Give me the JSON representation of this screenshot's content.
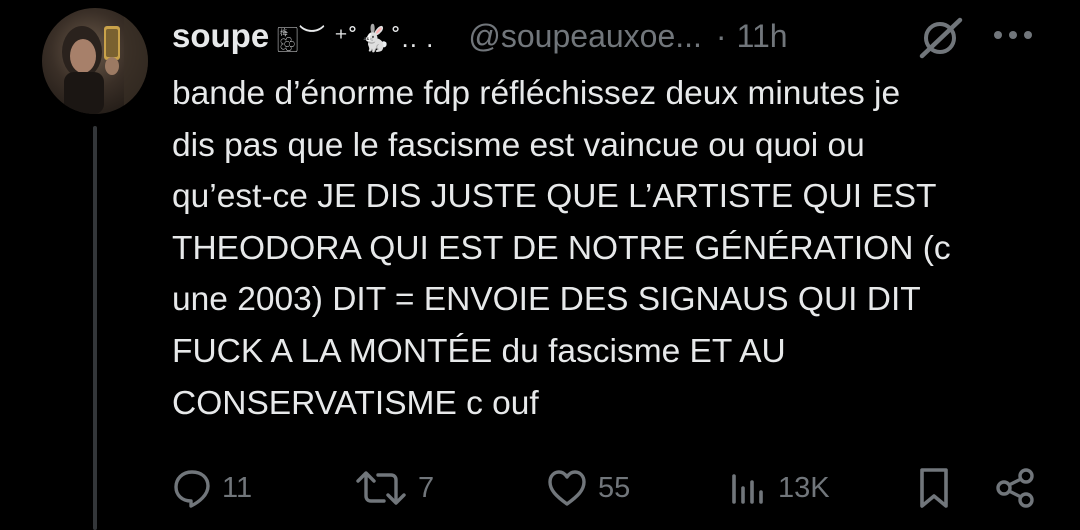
{
  "author": {
    "display_name": "soupe",
    "name_decoration": "🀢︶ ⁺˚🐇˚.. .",
    "handle": "@soupeauxoe...",
    "separator": "·",
    "time": "11h"
  },
  "tweet": {
    "text": "bande d’énorme fdp réfléchissez deux minutes je\ndis pas que le fascisme est vaincue ou quoi ou\nqu’est-ce JE DIS JUSTE QUE L’ARTISTE QUI EST\nTHEODORA QUI EST DE NOTRE GÉNÉRATION (c\nune 2003) DIT = ENVOIE DES SIGNAUS QUI DIT\nFUCK A LA MONTÉE du fascisme ET AU\nCONSERVATISME c ouf"
  },
  "actions": {
    "replies": "11",
    "reposts": "7",
    "likes": "55",
    "views": "13K"
  },
  "icons": {
    "slash": "grok-slash-icon",
    "more": "more-dots-icon",
    "reply": "reply-bubble-icon",
    "repost": "repost-icon",
    "like": "heart-icon",
    "views": "views-bar-chart-icon",
    "bookmark": "bookmark-icon",
    "share": "share-icon"
  },
  "colors": {
    "background": "#000000",
    "text_primary": "#e7e9ea",
    "text_secondary": "#71767b",
    "thread_line": "#333639"
  }
}
